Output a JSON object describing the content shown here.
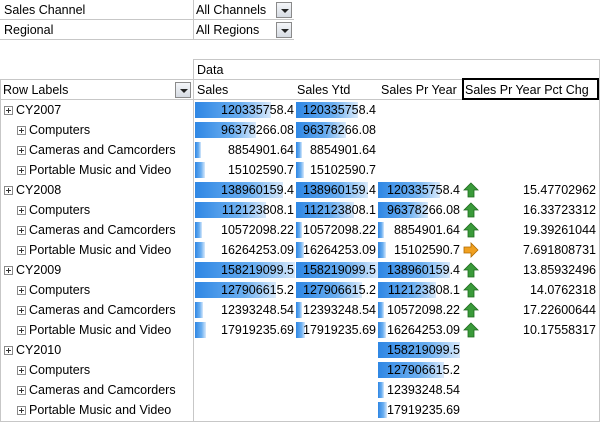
{
  "filters": [
    {
      "label": "Sales Channel",
      "value": "All Channels"
    },
    {
      "label": "Regional",
      "value": "All Regions"
    }
  ],
  "pivot": {
    "data_header": "Data",
    "row_labels_header": "Row Labels",
    "columns": [
      "Sales",
      "Sales Ytd",
      "Sales Pr Year",
      "Sales Pr Year Pct Chg"
    ],
    "rows": [
      {
        "label": "CY2007",
        "level": 0,
        "sales": "120335758.4",
        "ytd": "120335758.4",
        "pr": "",
        "arrow": "",
        "pct": ""
      },
      {
        "label": "Computers",
        "level": 1,
        "sales": "96378266.08",
        "ytd": "96378266.08",
        "pr": "",
        "arrow": "",
        "pct": ""
      },
      {
        "label": "Cameras and Camcorders",
        "level": 1,
        "sales": "8854901.64",
        "ytd": "8854901.64",
        "pr": "",
        "arrow": "",
        "pct": ""
      },
      {
        "label": "Portable Music and Video",
        "level": 1,
        "sales": "15102590.7",
        "ytd": "15102590.7",
        "pr": "",
        "arrow": "",
        "pct": ""
      },
      {
        "label": "CY2008",
        "level": 0,
        "sales": "138960159.4",
        "ytd": "138960159.4",
        "pr": "120335758.4",
        "arrow": "up",
        "pct": "15.47702962"
      },
      {
        "label": "Computers",
        "level": 1,
        "sales": "112123808.1",
        "ytd": "112123808.1",
        "pr": "96378266.08",
        "arrow": "up",
        "pct": "16.33723312"
      },
      {
        "label": "Cameras and Camcorders",
        "level": 1,
        "sales": "10572098.22",
        "ytd": "10572098.22",
        "pr": "8854901.64",
        "arrow": "up",
        "pct": "19.39261044"
      },
      {
        "label": "Portable Music and Video",
        "level": 1,
        "sales": "16264253.09",
        "ytd": "16264253.09",
        "pr": "15102590.7",
        "arrow": "right",
        "pct": "7.691808731"
      },
      {
        "label": "CY2009",
        "level": 0,
        "sales": "158219099.5",
        "ytd": "158219099.5",
        "pr": "138960159.4",
        "arrow": "up",
        "pct": "13.85932496"
      },
      {
        "label": "Computers",
        "level": 1,
        "sales": "127906615.2",
        "ytd": "127906615.2",
        "pr": "112123808.1",
        "arrow": "up",
        "pct": "14.0762318"
      },
      {
        "label": "Cameras and Camcorders",
        "level": 1,
        "sales": "12393248.54",
        "ytd": "12393248.54",
        "pr": "10572098.22",
        "arrow": "up",
        "pct": "17.22600644"
      },
      {
        "label": "Portable Music and Video",
        "level": 1,
        "sales": "17919235.69",
        "ytd": "17919235.69",
        "pr": "16264253.09",
        "arrow": "up",
        "pct": "10.17558317"
      },
      {
        "label": "CY2010",
        "level": 0,
        "sales": "",
        "ytd": "",
        "pr": "158219099.5",
        "arrow": "",
        "pct": ""
      },
      {
        "label": "Computers",
        "level": 1,
        "sales": "",
        "ytd": "",
        "pr": "127906615.2",
        "arrow": "",
        "pct": ""
      },
      {
        "label": "Cameras and Camcorders",
        "level": 1,
        "sales": "",
        "ytd": "",
        "pr": "12393248.54",
        "arrow": "",
        "pct": ""
      },
      {
        "label": "Portable Music and Video",
        "level": 1,
        "sales": "",
        "ytd": "",
        "pr": "17919235.69",
        "arrow": "",
        "pct": ""
      }
    ]
  },
  "colors": {
    "bar": "#2f87e4",
    "arrow_up": "#3a9a3a",
    "arrow_right": "#f0a020",
    "grid": "#c7c7c7"
  }
}
